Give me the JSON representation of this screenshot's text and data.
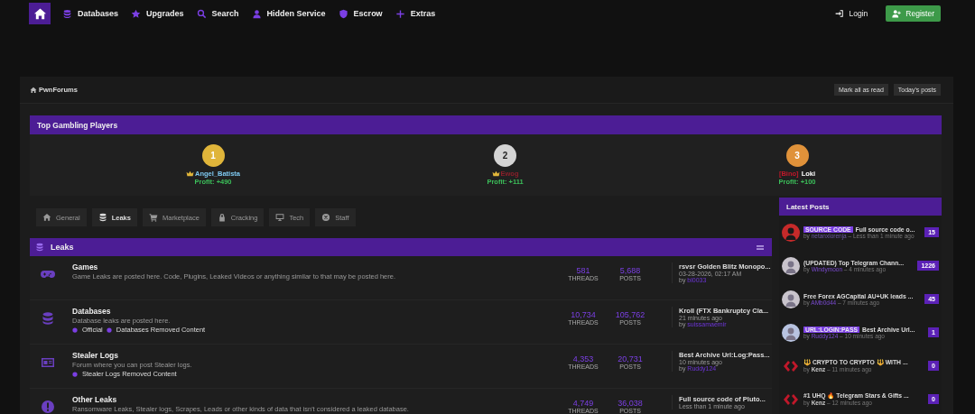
{
  "nav": {
    "items": [
      {
        "label": "Databases"
      },
      {
        "label": "Upgrades"
      },
      {
        "label": "Search"
      },
      {
        "label": "Hidden Service"
      },
      {
        "label": "Escrow"
      },
      {
        "label": "Extras"
      }
    ],
    "login": "Login",
    "register": "Register"
  },
  "breadcrumb": {
    "label": "PwnForums",
    "buttons": [
      "Mark all as read",
      "Today's posts"
    ]
  },
  "gambling": {
    "title": "Top Gambling Players",
    "players": [
      {
        "rank": "1",
        "color": "#e0b53a",
        "name": "Angel_Batista",
        "crown": true,
        "profit": "Profit: +490"
      },
      {
        "rank": "2",
        "color": "#d4d4d4",
        "name": "Ewog",
        "crown": true,
        "profit": "Profit: +111"
      },
      {
        "rank": "3",
        "color": "#e0923a",
        "prefix": "[Bino]",
        "name": "Loki",
        "crown": false,
        "profit": "Profit: +100"
      }
    ]
  },
  "tabs": [
    {
      "label": "General",
      "selected": false
    },
    {
      "label": "Leaks",
      "selected": true
    },
    {
      "label": "Marketplace",
      "selected": false
    },
    {
      "label": "Cracking",
      "selected": false
    },
    {
      "label": "Tech",
      "selected": false
    },
    {
      "label": "Staff",
      "selected": false
    }
  ],
  "forum": {
    "title": "Leaks",
    "rows": [
      {
        "name": "Games",
        "description": "Game Leaks are posted here. Code, Plugins, Leaked Videos or anything similar to that may be posted here.",
        "threads": "581",
        "threads_label": "THREADS",
        "posts": "5,688",
        "posts_label": "POSTS",
        "last_title": "rsvsr Golden Blitz Monopo...",
        "last_time": "03-28-2026, 02:17 AM",
        "last_by": "by",
        "last_user": "bl0033"
      },
      {
        "name": "Databases",
        "description": "Database leaks are posted here.",
        "subforums": [
          "Official",
          "Databases Removed Content"
        ],
        "threads": "10,734",
        "threads_label": "THREADS",
        "posts": "105,762",
        "posts_label": "POSTS",
        "last_title": "Kroll (FTX Bankruptcy Cla...",
        "last_time": "21 minutes ago",
        "last_by": "by",
        "last_user": "suissamaemir"
      },
      {
        "name": "Stealer Logs",
        "description": "Forum where you can post Stealer logs.",
        "subforums": [
          "Stealer Logs Removed Content"
        ],
        "threads": "4,353",
        "threads_label": "THREADS",
        "posts": "20,731",
        "posts_label": "POSTS",
        "last_title": "Best Archive Url:Log:Pass...",
        "last_time": "10 minutes ago",
        "last_by": "by",
        "last_user": "Ruddy124"
      },
      {
        "name": "Other Leaks",
        "description": "Ransomware Leaks, Stealer logs, Scrapes, Leads or other kinds of data that isn't considered a leaked database.",
        "threads": "4,749",
        "threads_label": "THREADS",
        "posts": "36,038",
        "posts_label": "POSTS",
        "last_title": "Full source code of Pluto...",
        "last_time": "Less than 1 minute ago"
      }
    ]
  },
  "latest": {
    "title": "Latest Posts",
    "posts": [
      {
        "tag": "SOURCE CODE",
        "title": "Full source code o...",
        "by": "by",
        "user": "netanxlorenja",
        "time": "– Less than 1 minute ago",
        "count": "15"
      },
      {
        "title": "(UPDATED) Top Telegram Chann...",
        "by": "by",
        "user": "Windymoon",
        "time": "– 4 minutes ago",
        "count": "1226"
      },
      {
        "title": "Free Forex AGCapital AU+UK leads ...",
        "by": "by",
        "user": "AMb0d44",
        "time": "– 7 minutes ago",
        "count": "45"
      },
      {
        "tag": "URL:LOGIN:PASS",
        "title": "Best Archive Url...",
        "by": "by",
        "user": "Ruddy124",
        "time": "– 10 minutes ago",
        "count": "1"
      },
      {
        "title": "🔱 CRYPTO TO CRYPTO 🔱 WITH ...",
        "by": "by",
        "user": "Kenz",
        "time": "– 11 minutes ago",
        "count": "0"
      },
      {
        "title": "#1 UHQ 🔥 Telegram Stars & Gifts ...",
        "by": "by",
        "user": "Kenz",
        "time": "– 12 minutes ago",
        "count": "0"
      }
    ]
  }
}
